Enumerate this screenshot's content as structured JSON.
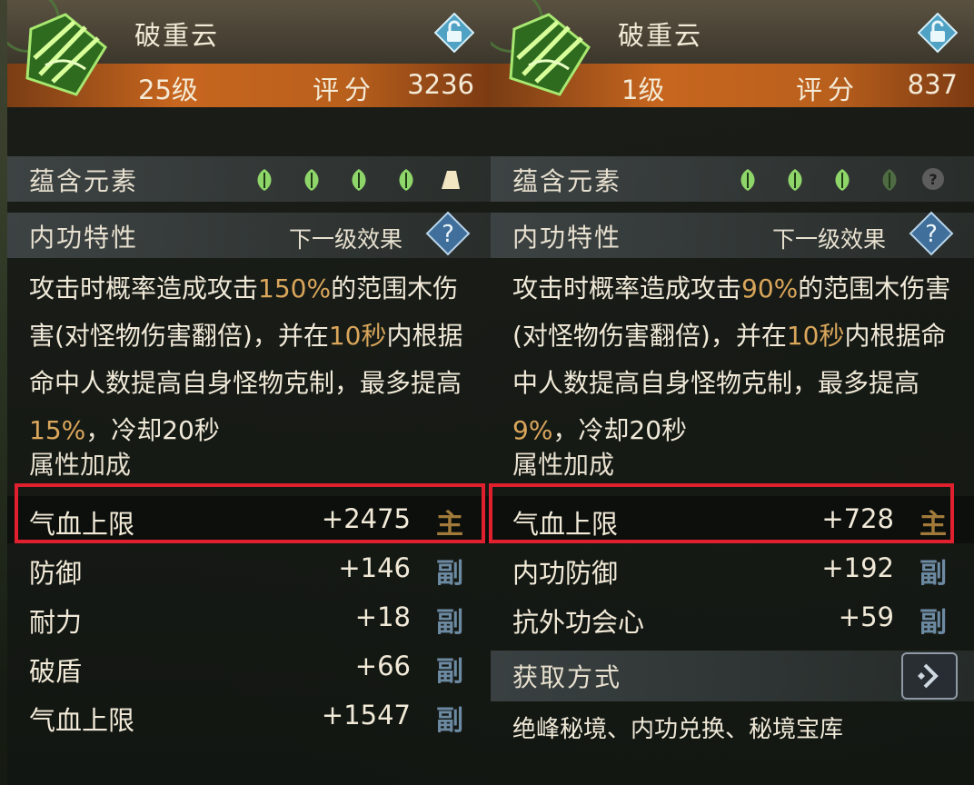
{
  "left": {
    "skill_name": "破重云",
    "level": "25级",
    "score_label": "评分",
    "score_value": "3236",
    "elements_label": "蕴含元素",
    "traits_label": "内功特性",
    "next_level_label": "下一级效果",
    "description": {
      "p1": "攻击时概率造成攻击",
      "h1": "150%",
      "p2": "的范围木伤害(对怪物伤害翻倍)，并在",
      "h2": "10秒",
      "p3": "内根据命中人数提高自身怪物克制，最多提高",
      "h3": "15%",
      "p4": "，冷却20秒"
    },
    "attr_header": "属性加成",
    "attrs": [
      {
        "name": "气血上限",
        "value": "+2475",
        "tag": "主"
      },
      {
        "name": "防御",
        "value": "+146",
        "tag": "副"
      },
      {
        "name": "耐力",
        "value": "+18",
        "tag": "副"
      },
      {
        "name": "破盾",
        "value": "+66",
        "tag": "副"
      },
      {
        "name": "气血上限",
        "value": "+1547",
        "tag": "副"
      }
    ]
  },
  "right": {
    "skill_name": "破重云",
    "level": "1级",
    "score_label": "评分",
    "score_value": "837",
    "elements_label": "蕴含元素",
    "traits_label": "内功特性",
    "next_level_label": "下一级效果",
    "description": {
      "p1": "攻击时概率造成攻击",
      "h1": "90%",
      "p2": "的范围木伤害(对怪物伤害翻倍)，并在",
      "h2": "10秒",
      "p3": "内根据命中人数提高自身怪物克制，最多提高",
      "h3": "9%",
      "p4": "，冷却20秒"
    },
    "attr_header": "属性加成",
    "attrs": [
      {
        "name": "气血上限",
        "value": "+728",
        "tag": "主"
      },
      {
        "name": "内功防御",
        "value": "+192",
        "tag": "副"
      },
      {
        "name": "抗外功会心",
        "value": "+59",
        "tag": "副"
      }
    ],
    "source_label": "获取方式",
    "source_text": "绝峰秘境、内功兑换、秘境宝库"
  },
  "colors": {
    "highlight": "#d9a65b",
    "tag_main": "#a27a3a",
    "tag_sub": "#6d8aa3",
    "box": "#e0202e"
  },
  "icons": [
    "leaf-icon",
    "mountain-icon",
    "question-icon",
    "lock-icon",
    "help-diamond-icon",
    "arrow-icon"
  ]
}
